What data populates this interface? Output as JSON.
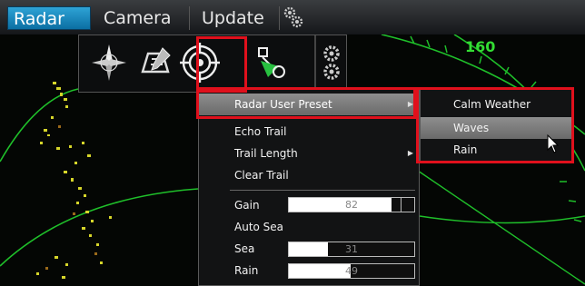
{
  "tabs": [
    {
      "label": "Radar",
      "active": true
    },
    {
      "label": "Camera",
      "active": false
    },
    {
      "label": "Update",
      "active": false
    }
  ],
  "tab_icon": "gears-icon",
  "radar": {
    "range_label": "160",
    "colors": {
      "ring": "#1fbf2a",
      "echo": "#d6d62a",
      "background": "#040604"
    }
  },
  "toolbar_icons": [
    "compass-icon",
    "chart-tools-icon",
    "radar-target-icon",
    "waypoint-icon",
    "settings-gears-icon"
  ],
  "main_menu": {
    "preset_label": "Radar User Preset",
    "echo_trail": "Echo Trail",
    "trail_length": "Trail Length",
    "clear_trail": "Clear Trail",
    "gain": {
      "label": "Gain",
      "value": "82",
      "level": 0.82
    },
    "auto_sea": "Auto Sea",
    "sea": {
      "label": "Sea",
      "value": "31",
      "level": 0.31
    },
    "rain": {
      "label": "Rain",
      "value": "49",
      "level": 0.49
    }
  },
  "sub_menu": {
    "items": [
      "Calm Weather",
      "Waves",
      "Rain"
    ],
    "selected": "Waves"
  },
  "highlight_color": "#e0101c"
}
